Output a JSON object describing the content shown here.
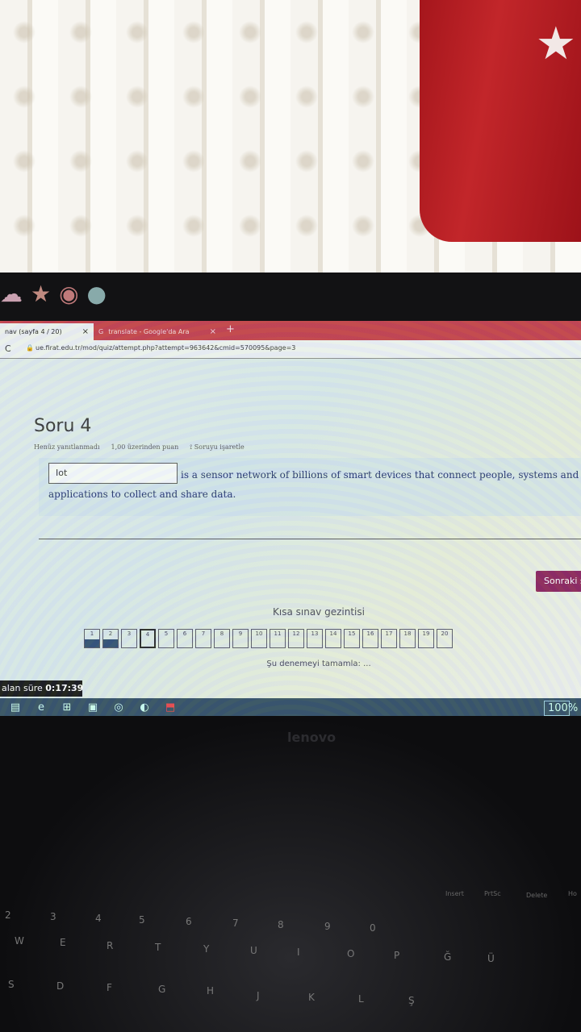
{
  "browser": {
    "tabs": [
      {
        "label": "nav (sayfa 4 / 20)",
        "close": "×"
      },
      {
        "label": "translate - Google'da Ara",
        "close": "×"
      }
    ],
    "new_tab": "+",
    "url": "ue.firat.edu.tr/mod/quiz/attempt.php?attempt=963642&cmid=570095&page=3"
  },
  "question": {
    "title": "Soru 4",
    "status": "Henüz yanıtlanmadı",
    "points": "1,00 üzerinden puan",
    "flag_label": "Soruyu işaretle",
    "answer_value": "Iot",
    "text_line1": "is a sensor network of billions of smart devices that connect people, systems and other",
    "text_line2": "applications to collect and share data."
  },
  "next_button": "Sonraki s",
  "quiz_nav": {
    "title": "Kısa sınav gezintisi",
    "buttons": [
      {
        "num": "1",
        "state": "answered"
      },
      {
        "num": "2",
        "state": "answered"
      },
      {
        "num": "3",
        "state": "empty"
      },
      {
        "num": "4",
        "state": "current"
      },
      {
        "num": "5",
        "state": "empty"
      },
      {
        "num": "6",
        "state": "empty"
      },
      {
        "num": "7",
        "state": "empty"
      },
      {
        "num": "8",
        "state": "empty"
      },
      {
        "num": "9",
        "state": "empty"
      },
      {
        "num": "10",
        "state": "empty"
      },
      {
        "num": "11",
        "state": "empty"
      },
      {
        "num": "12",
        "state": "empty"
      },
      {
        "num": "13",
        "state": "empty"
      },
      {
        "num": "14",
        "state": "empty"
      },
      {
        "num": "15",
        "state": "empty"
      },
      {
        "num": "16",
        "state": "empty"
      },
      {
        "num": "17",
        "state": "empty"
      },
      {
        "num": "18",
        "state": "empty"
      },
      {
        "num": "19",
        "state": "empty"
      },
      {
        "num": "20",
        "state": "empty"
      }
    ],
    "finish_link": "Şu denemeyi tamamla: ..."
  },
  "timer": {
    "label": "alan süre",
    "value": "0:17:39"
  },
  "taskbar": {
    "icons": [
      "file-explorer-icon",
      "edge-icon",
      "store-icon",
      "app-icon",
      "chrome-icon",
      "edge-new-icon",
      "pdf-icon"
    ],
    "battery": "100%"
  },
  "laptop": {
    "brand": "lenovo"
  },
  "keyboard_keys": [
    {
      "t": "Insert"
    },
    {
      "t": "PrtSc"
    },
    {
      "t": "Delete"
    },
    {
      "t": "Ho"
    },
    {
      "t": "2"
    },
    {
      "t": "3"
    },
    {
      "t": "4"
    },
    {
      "t": "5"
    },
    {
      "t": "6"
    },
    {
      "t": "7"
    },
    {
      "t": "8"
    },
    {
      "t": "9"
    },
    {
      "t": "0"
    },
    {
      "t": "W"
    },
    {
      "t": "E"
    },
    {
      "t": "R"
    },
    {
      "t": "T"
    },
    {
      "t": "Y"
    },
    {
      "t": "U"
    },
    {
      "t": "I"
    },
    {
      "t": "O"
    },
    {
      "t": "P"
    },
    {
      "t": "Ğ"
    },
    {
      "t": "Ü"
    },
    {
      "t": "S"
    },
    {
      "t": "D"
    },
    {
      "t": "F"
    },
    {
      "t": "G"
    },
    {
      "t": "H"
    },
    {
      "t": "J"
    },
    {
      "t": "K"
    },
    {
      "t": "L"
    },
    {
      "t": "Ş"
    }
  ]
}
